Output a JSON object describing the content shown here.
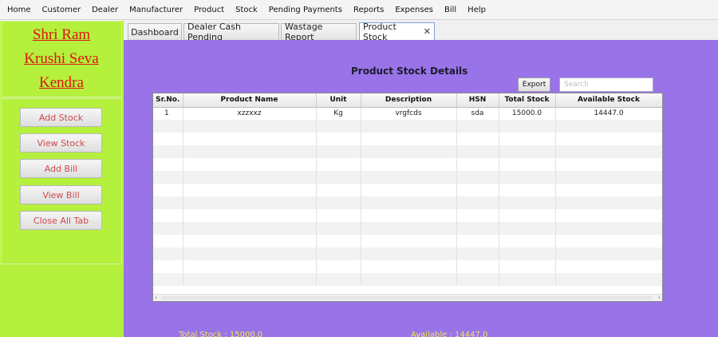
{
  "menu": [
    "Home",
    "Customer",
    "Dealer",
    "Manufacturer",
    "Product",
    "Stock",
    "Pending Payments",
    "Reports",
    "Expenses",
    "Bill",
    "Help"
  ],
  "brand": {
    "line1": "Shri Ram ",
    "line2": "Krushi Seva ",
    "line3": "Kendra"
  },
  "sidebar": {
    "buttons": [
      "Add Stock",
      "View Stock",
      "Add Bill",
      "View Bill",
      "Close All Tab"
    ]
  },
  "tabs": [
    "Dashboard",
    "Dealer Cash Pending",
    "Wastage Report",
    "Product Stock"
  ],
  "active_tab_index": 3,
  "panel": {
    "title": "Product Stock Details",
    "export_label": "Export",
    "search_placeholder": "Search"
  },
  "table": {
    "columns": [
      "Sr.No.",
      "Product Name",
      "Unit",
      "Description",
      "HSN",
      "Total Stock",
      "Available Stock"
    ],
    "rows": [
      [
        "1",
        "xzzxxz",
        "Kg",
        "vrgfcds",
        "sda",
        "15000.0",
        "14447.0"
      ]
    ]
  },
  "footer": {
    "total_stock": "Total Stock : 15000.0",
    "available": "Available : 14447.0"
  },
  "colors": {
    "panel_bg": "#9973e8",
    "sidebar_bg": "#b4f03c",
    "brand_text": "#e01414",
    "footer_text": "#f3e65a"
  }
}
